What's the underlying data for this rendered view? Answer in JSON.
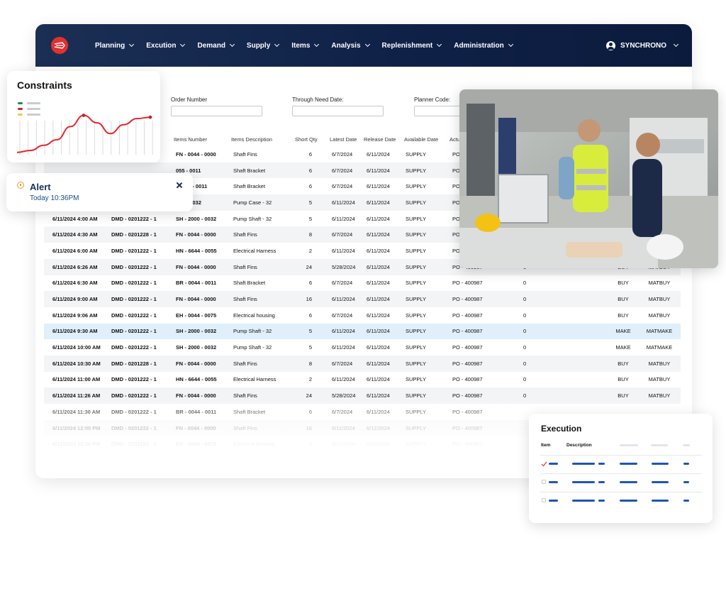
{
  "nav": {
    "menu": [
      "Planning",
      "Excution",
      "Demand",
      "Supply",
      "Items",
      "Analysis",
      "Replenishment",
      "Administration"
    ],
    "user": "SYNCHRONO",
    "brand_color": "#0f2147",
    "logo_color": "#e0312f"
  },
  "filters": {
    "order_number": "Order Number",
    "through_need_date": "Through Need Date:",
    "planner_code": "Planner Code:"
  },
  "table": {
    "headers": [
      "Items Number",
      "Items Description",
      "Short Qty",
      "Latest Date",
      "Release Date",
      "Available Date",
      "Actu"
    ],
    "rows": [
      {
        "c0": "",
        "c1": "",
        "c2": "FN - 0044 - 0000",
        "c3": "Shaft Fins",
        "c4": "6",
        "c5": "6/7/2024",
        "c6": "6/11/2024",
        "c7": "SUPPLY",
        "c8": "PO",
        "c9": "",
        "c10": "",
        "c11": ""
      },
      {
        "c0": "",
        "c1": "",
        "c2": "055 - 0011",
        "c3": "Shaft Bracket",
        "c4": "6",
        "c5": "6/7/2024",
        "c6": "6/11/2024",
        "c7": "SUPPLY",
        "c8": "PO",
        "c9": "",
        "c10": "",
        "c11": ""
      },
      {
        "c0": "",
        "c1": "",
        "c2": "- 6644 - 0011",
        "c3": "Shaft Bracket",
        "c4": "6",
        "c5": "6/7/2024",
        "c6": "6/11/2024",
        "c7": "SUPPLY",
        "c8": "PO",
        "c9": "",
        "c10": "",
        "c11": ""
      },
      {
        "c0": "",
        "c1": "",
        "c2": "000 - 0032",
        "c3": "Pump Case - 32",
        "c4": "5",
        "c5": "6/11/2024",
        "c6": "6/11/2024",
        "c7": "SUPPLY",
        "c8": "PO",
        "c9": "",
        "c10": "",
        "c11": ""
      },
      {
        "c0": "6/11/2024 4:00 AM",
        "c1": "DMD - 0201222 - 1",
        "c2": "SH - 2000 - 0032",
        "c3": "Pump Shaft - 32",
        "c4": "5",
        "c5": "6/11/2024",
        "c6": "6/11/2024",
        "c7": "SUPPLY",
        "c8": "PO",
        "c9": "",
        "c10": "",
        "c11": ""
      },
      {
        "c0": "6/11/2024 4:30 AM",
        "c1": "DMD - 0201228 - 1",
        "c2": "FN - 0044 - 0000",
        "c3": "Shaft Fins",
        "c4": "8",
        "c5": "6/7/2024",
        "c6": "6/11/2024",
        "c7": "SUPPLY",
        "c8": "PO",
        "c9": "",
        "c10": "",
        "c11": ""
      },
      {
        "c0": "6/11/2024 6:00 AM",
        "c1": "DMD - 0201222 - 1",
        "c2": "HN - 6644 - 0055",
        "c3": "Electrical Harness",
        "c4": "2",
        "c5": "6/11/2024",
        "c6": "6/11/2024",
        "c7": "SUPPLY",
        "c8": "PO",
        "c9": "",
        "c10": "",
        "c11": ""
      },
      {
        "c0": "6/11/2024 6:26 AM",
        "c1": "DMD - 0201222 - 1",
        "c2": "FN - 0044 - 0000",
        "c3": "Shaft Fins",
        "c4": "24",
        "c5": "5/28/2024",
        "c6": "6/11/2024",
        "c7": "SUPPLY",
        "c8": "PO - 400987",
        "c9": "0",
        "c10": "BUY",
        "c11": "MATBUY"
      },
      {
        "c0": "6/11/2024 6:30 AM",
        "c1": "DMD - 0201222 - 1",
        "c2": "BR - 0044 - 0011",
        "c3": "Shaft Bracket",
        "c4": "6",
        "c5": "6/7/2024",
        "c6": "6/11/2024",
        "c7": "SUPPLY",
        "c8": "PO - 400987",
        "c9": "0",
        "c10": "BUY",
        "c11": "MATBUY"
      },
      {
        "c0": "6/11/2024 9:00 AM",
        "c1": "DMD - 0201222 - 1",
        "c2": "FN - 0044 - 0000",
        "c3": "Shaft Fins",
        "c4": "16",
        "c5": "6/11/2024",
        "c6": "6/11/2024",
        "c7": "SUPPLY",
        "c8": "PO - 400987",
        "c9": "0",
        "c10": "BUY",
        "c11": "MATBUY"
      },
      {
        "c0": "6/11/2024 9:06 AM",
        "c1": "DMD - 0201222 - 1",
        "c2": "EH - 0044 - 0075",
        "c3": "Electrical housing",
        "c4": "6",
        "c5": "6/7/2024",
        "c6": "6/11/2024",
        "c7": "SUPPLY",
        "c8": "PO - 400987",
        "c9": "0",
        "c10": "BUY",
        "c11": "MATBUY"
      },
      {
        "c0": "6/11/2024 9:30 AM",
        "c1": "DMD - 0201222 - 1",
        "c2": "SH - 2000 - 0032",
        "c3": "Pump Shaft - 32",
        "c4": "5",
        "c5": "6/11/2024",
        "c6": "6/11/2024",
        "c7": "SUPPLY",
        "c8": "PO - 400987",
        "c9": "0",
        "c10": "MAKE",
        "c11": "MATMAKE"
      },
      {
        "c0": "6/11/2024 10:00 AM",
        "c1": "DMD - 0201222 - 1",
        "c2": "SH - 2000 - 0032",
        "c3": "Pump Shaft - 32",
        "c4": "5",
        "c5": "6/11/2024",
        "c6": "6/11/2024",
        "c7": "SUPPLY",
        "c8": "PO - 400987",
        "c9": "0",
        "c10": "MAKE",
        "c11": "MATMAKE"
      },
      {
        "c0": "6/11/2024 10:30 AM",
        "c1": "DMD - 0201228 - 1",
        "c2": "FN - 0044 - 0000",
        "c3": "Shaft Fins",
        "c4": "8",
        "c5": "6/7/2024",
        "c6": "6/11/2024",
        "c7": "SUPPLY",
        "c8": "PO - 400987",
        "c9": "0",
        "c10": "BUY",
        "c11": "MATBUY"
      },
      {
        "c0": "6/11/2024 11:00 AM",
        "c1": "DMD - 0201222 - 1",
        "c2": "HN - 6644 - 0055",
        "c3": "Electrical Harness",
        "c4": "2",
        "c5": "6/11/2024",
        "c6": "6/11/2024",
        "c7": "SUPPLY",
        "c8": "PO - 400987",
        "c9": "0",
        "c10": "BUY",
        "c11": "MATBUY"
      },
      {
        "c0": "6/11/2024 11:26 AM",
        "c1": "DMD - 0201222 - 1",
        "c2": "FN - 0044 - 0000",
        "c3": "Shaft Fins",
        "c4": "24",
        "c5": "5/28/2024",
        "c6": "6/11/2024",
        "c7": "SUPPLY",
        "c8": "PO - 400987",
        "c9": "0",
        "c10": "BUY",
        "c11": "MATBUY"
      },
      {
        "c0": "6/11/2024 11:30 AM",
        "c1": "DMD - 0201222 - 1",
        "c2": "BR - 0044 - 0011",
        "c3": "Shaft Bracket",
        "c4": "6",
        "c5": "6/7/2024",
        "c6": "6/11/2024",
        "c7": "SUPPLY",
        "c8": "PO - 400987",
        "c9": "",
        "c10": "",
        "c11": ""
      },
      {
        "c0": "6/11/2024 12:00 PM",
        "c1": "DMD - 0201222 - 1",
        "c2": "FN - 0044 - 0000",
        "c3": "Shaft Fins",
        "c4": "16",
        "c5": "6/11/2024",
        "c6": "6/11/2024",
        "c7": "SUPPLY",
        "c8": "PO - 400987",
        "c9": "",
        "c10": "",
        "c11": ""
      },
      {
        "c0": "6/11/2024 12:06 PM",
        "c1": "DMD - 0201222 - 1",
        "c2": "EH - 0044 - 0075",
        "c3": "Electrical housing",
        "c4": "6",
        "c5": "6/11/2024",
        "c6": "6/11/2024",
        "c7": "SUPPLY",
        "c8": "PO - 400987",
        "c9": "",
        "c10": "",
        "c11": ""
      }
    ],
    "selected_row": 11
  },
  "constraints": {
    "title": "Constraints",
    "legend_colors": [
      "#1e8a47",
      "#c0282f",
      "#f2c94c"
    ],
    "line_color": "#e3282d",
    "series": [
      0.05,
      0.09,
      0.2,
      0.32,
      0.6,
      0.84,
      0.68,
      0.45,
      0.64,
      0.77,
      0.8
    ]
  },
  "alert": {
    "title": "Alert",
    "time": "Today 10:36PM"
  },
  "execution": {
    "title": "Execution",
    "col_item": "Item",
    "col_description": "Description",
    "accent": "#1f56b1"
  }
}
